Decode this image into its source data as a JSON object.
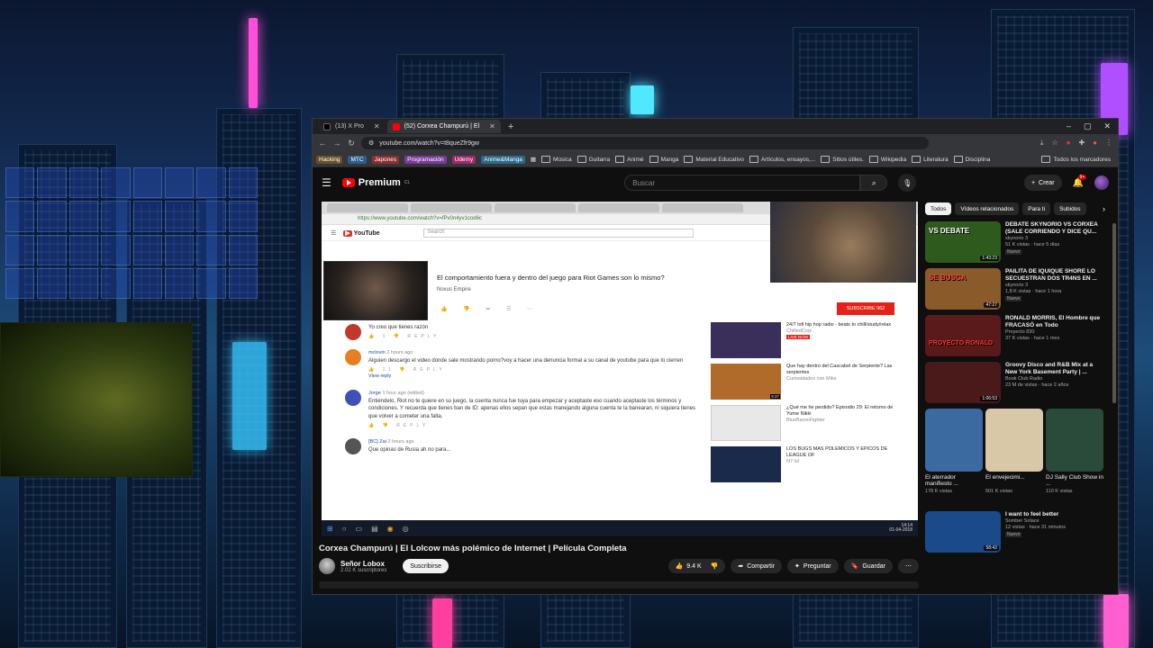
{
  "browser": {
    "tabs": [
      {
        "title": "(13) X Pro",
        "color": "#111111"
      },
      {
        "title": "(52) Corxea Champurú | El",
        "color": "#ff0000"
      }
    ],
    "new_tab": "+",
    "controls": [
      "–",
      "▢",
      "✕"
    ],
    "url": "youtube.com/watch?v=t8queZfr9gw",
    "bookmarks_chips": [
      {
        "label": "Hacking",
        "color": "#6b4f2a"
      },
      {
        "label": "MTC",
        "color": "#2f5d8a"
      },
      {
        "label": "Japones",
        "color": "#8a2f2f"
      },
      {
        "label": "Programación",
        "color": "#7a3a9a"
      },
      {
        "label": "Udemy",
        "color": "#a0296a"
      },
      {
        "label": "Anime&Manga",
        "color": "#2a6a8a"
      }
    ],
    "bookmarks_folders": [
      "Música",
      "Guitarra",
      "Animé",
      "Manga",
      "Material Educativo",
      "Artículos, ensayos,...",
      "Sitios útiles.",
      "Wikipedia",
      "Literatura",
      "Disciplina"
    ],
    "bookmarks_all": "Todos los marcadores"
  },
  "youtube": {
    "logo_text": "Premium",
    "logo_suffix": "CL",
    "search_placeholder": "Buscar",
    "create_label": "Crear",
    "notif_count": "9+",
    "video_title": "Corxea Champurú | El Lolcow más polémico de Internet | Película Completa",
    "channel_name": "Señor Lobox",
    "channel_subs": "2.02 K suscriptores",
    "subscribe_label": "Suscribirse",
    "likes": "9.4 K",
    "share_label": "Compartir",
    "ask_label": "Preguntar",
    "save_label": "Guardar"
  },
  "player": {
    "inner_url": "https://www.youtube.com/watch?v=fPv0n4yv1cod6c",
    "inner_logo": "YouTube",
    "inner_search": "Search",
    "inner_title": "El comportamiento fuera y dentro del juego para Riot Games son lo mismo?",
    "inner_channel": "Noxus Empire",
    "inner_subscribe": "SUBSCRIBE  962",
    "comments": [
      {
        "name": "",
        "meta": "",
        "text": "Yo creo que tienes razón",
        "color": "#c0392b"
      },
      {
        "name": "mclovin",
        "meta": "2 hours ago",
        "text": "Alguien descargo el video donde sale mostrando porno?voy a hacer una denuncia formal a su canal de youtube para que lo cierren",
        "color": "#e67e22"
      },
      {
        "name": "Jorge",
        "meta": "1 hour ago (edited)",
        "text": "Entiéndelo, Riot no te quiere en su juego, la cuenta nunca fue tuya para empezar y aceptaste eso cuando aceptaste los términos y condiciones. Y recuerda que tienes ban de ID: apenas ellos sepan que estas manejando alguna cuenta te la banearan, ni siquiera tienes que volver a cometer una falta.",
        "color": "#3f51b5"
      },
      {
        "name": "[BC] Zai",
        "meta": "2 hours ago",
        "text": "Que opinas de Rusia ah no para...",
        "color": "#555555"
      }
    ],
    "view_reply": "View reply",
    "related": [
      {
        "title": "24/7 lofi hip hop radio - beats to chill/study/relax",
        "sub": "ChilledCow",
        "live": "LIVE NOW",
        "dur": "",
        "color": "#3a2e5a"
      },
      {
        "title": "Que hay dentro del Cascabel de Serpiente? Las serpientes",
        "sub": "Curiosidades con Mike",
        "live": "",
        "dur": "9:37",
        "color": "#b06a2a"
      },
      {
        "title": "¿Qué me he perdido? Episodio 29: El retorno de Yume Nikki",
        "sub": "BlueBaronFighter",
        "live": "",
        "dur": "",
        "color": "#e8e8e8"
      },
      {
        "title": "LOS BUGS MAS POLEMICOS Y EPICOS DE LEAGUE OF",
        "sub": "N7 lol",
        "live": "",
        "dur": "",
        "color": "#1a2a4a"
      }
    ],
    "taskbar_time": "14:14",
    "taskbar_date": "01-04-2018"
  },
  "sidebar": {
    "chips": [
      "Todos",
      "Vídeos relacionados",
      "Para ti",
      "Subidos"
    ],
    "videos": [
      {
        "title": "DEBATE SKYNORIO VS CORXEA (SALE CORRIENDO Y DICE QU...",
        "channel": "skynorio 3",
        "views": "51 K vistas · hace 5 días",
        "badge": "Nuevo",
        "dur": "1:43:23",
        "overlay": "VS DEBATE",
        "color": "#2e5a1e"
      },
      {
        "title": "PAILITA DE IQUIQUE SHORE LO SECUESTRAN DOS TR4NS EN ...",
        "channel": "skynorio 3",
        "views": "1,8 K vistas · hace 1 hora",
        "badge": "Nuevo",
        "dur": "47:27",
        "overlay": "SE BUSCA",
        "color": "#8a5a2a"
      },
      {
        "title": "RONALD MORRIS, El Hombre que FRACASÓ en Todo",
        "channel": "Proyecto 830",
        "views": "37 K vistas · hace 1 mes",
        "badge": "",
        "dur": "",
        "overlay": "PROYECTO RONALD",
        "color": "#5a1a1a"
      },
      {
        "title": "Groovy Disco and R&B Mix at a New York Basement Party | ...",
        "channel": "Book Club Radio",
        "views": "23 M de vistas · hace 2 años",
        "badge": "",
        "dur": "1:06:53",
        "overlay": "",
        "color": "#4a1a1a"
      }
    ],
    "shorts": [
      {
        "title": "El aterrador manifiesto ...",
        "views": "178 K vistas",
        "color": "#3a6aa0"
      },
      {
        "title": "El envejecimi...",
        "views": "501 K vistas",
        "color": "#d8c8a8"
      },
      {
        "title": "DJ Sally Club Show in ...",
        "views": "110 K vistas",
        "color": "#2a4a3a"
      }
    ],
    "last": {
      "title": "I want to feel better",
      "channel": "Somber Solace",
      "views": "12 vistas · hace 31 minutos",
      "badge": "Nuevo",
      "dur": "58:42",
      "color": "#1a4a8a"
    }
  }
}
